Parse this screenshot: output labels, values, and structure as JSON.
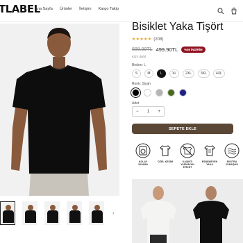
{
  "header": {
    "logo": "TLABEL",
    "nav": [
      "Ana Sayfa",
      "Ürünler",
      "İletişim",
      "Kargo Takip"
    ],
    "icons": [
      "search-icon",
      "cart-icon"
    ]
  },
  "gallery": {
    "thumbnail_count": 5,
    "active_index": 0,
    "next_icon": "chevron-right-icon",
    "next_glyph": "›"
  },
  "product": {
    "title": "Bisiklet Yaka Tişört",
    "stars": "★★★★★",
    "rating_value": 5,
    "rating_count": "(208)",
    "old_price": "899.99TL",
    "new_price": "499.90TL",
    "discount_badge": "%56 İNDİRİM",
    "tax_note": "KDV dahil",
    "size_label": "Beden: L",
    "sizes": [
      "S",
      "M",
      "L",
      "XL",
      "2XL",
      "3XL",
      "4XL"
    ],
    "selected_size": "L",
    "color_label": "Renk: Siyah",
    "colors": [
      "#000000",
      "#ffffff",
      "#b5b5b5",
      "#4a6b1f",
      "#1f1f8a"
    ],
    "selected_color_index": 0,
    "quantity_label": "Adet",
    "quantity": "1",
    "qty_minus": "−",
    "qty_plus": "+",
    "add_to_cart": "SEPETE EKLE"
  },
  "features": [
    {
      "icon": "washing-machine-icon",
      "label": "KOLAY\nYIKAMA"
    },
    {
      "icon": "tshirt-icon",
      "label": "ÖZEL KESİM"
    },
    {
      "icon": "no-sweat-icon",
      "label": "KAŞINTI\nYAPMAYAN\nETİKET"
    },
    {
      "icon": "tshirt-stretch-icon",
      "label": "ESNEMEYEN\nYAKA"
    },
    {
      "icon": "fabric-icon",
      "label": "EKSTRA\nYUMUŞAK"
    }
  ]
}
